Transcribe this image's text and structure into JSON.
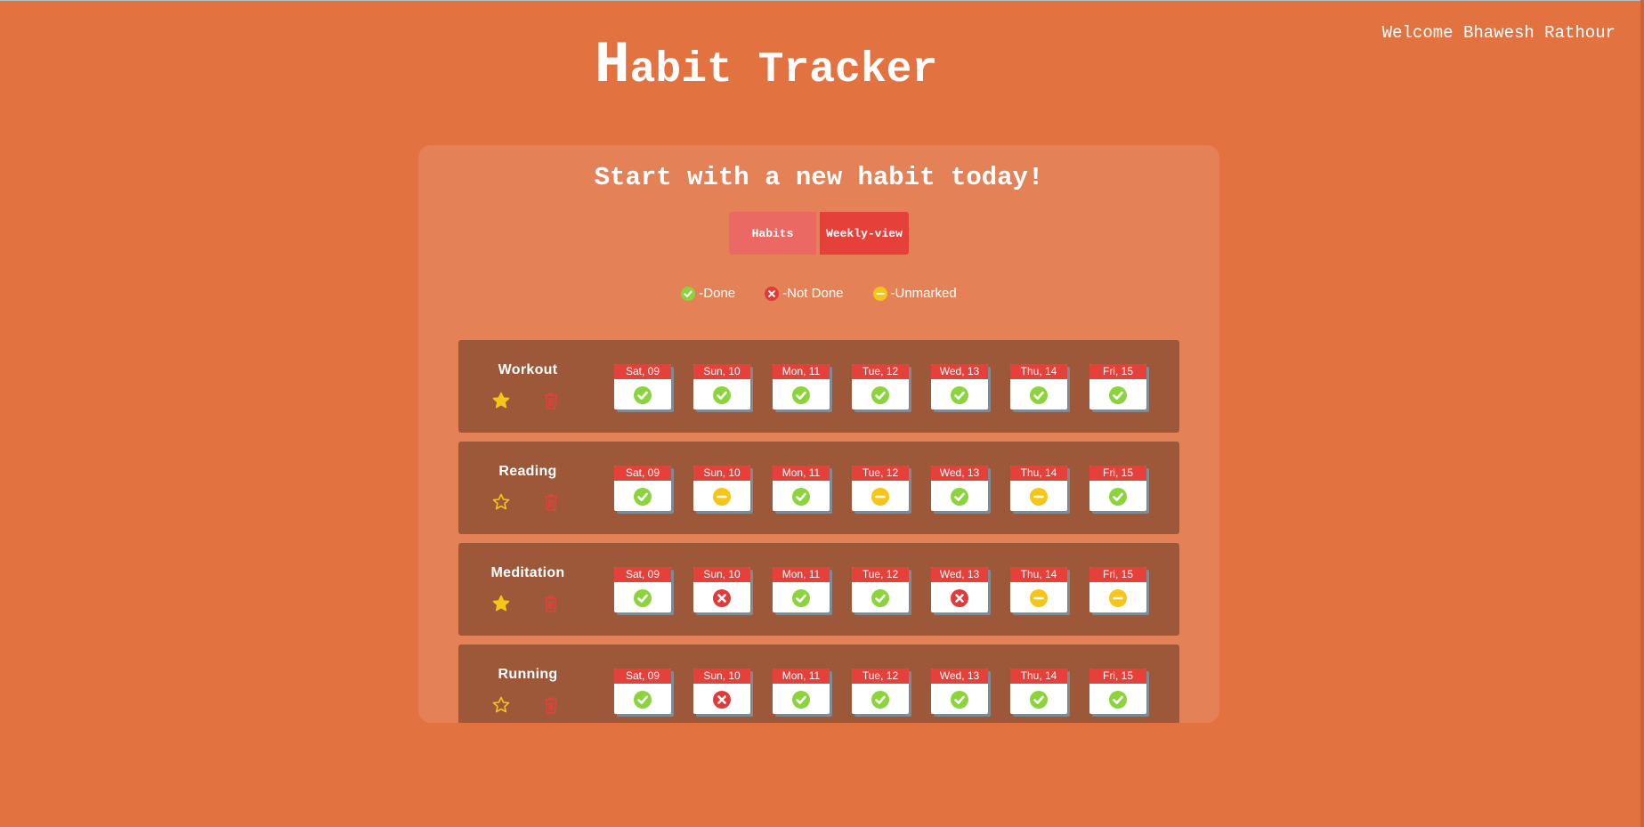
{
  "header": {
    "welcome": "Welcome Bhawesh Rathour",
    "title_initial": "H",
    "title_rest": "abit Tracker"
  },
  "main": {
    "subtitle": "Start with a new habit today!",
    "tabs": [
      {
        "label": "Habits"
      },
      {
        "label": "Weekly-view",
        "active": true
      }
    ],
    "legend": [
      {
        "status": "done",
        "label": "-Done"
      },
      {
        "status": "not-done",
        "label": "-Not Done"
      },
      {
        "status": "unmarked",
        "label": "-Unmarked"
      }
    ]
  },
  "days": [
    "Sat, 09",
    "Sun, 10",
    "Mon, 11",
    "Tue, 12",
    "Wed, 13",
    "Thu, 14",
    "Fri, 15"
  ],
  "habits": [
    {
      "name": "Workout",
      "favorite": true,
      "statuses": [
        "done",
        "done",
        "done",
        "done",
        "done",
        "done",
        "done"
      ]
    },
    {
      "name": "Reading",
      "favorite": false,
      "statuses": [
        "done",
        "unmarked",
        "done",
        "unmarked",
        "done",
        "unmarked",
        "done"
      ]
    },
    {
      "name": "Meditation",
      "favorite": true,
      "statuses": [
        "done",
        "not-done",
        "done",
        "done",
        "not-done",
        "unmarked",
        "unmarked"
      ]
    },
    {
      "name": "Running",
      "favorite": false,
      "statuses": [
        "done",
        "not-done",
        "done",
        "done",
        "done",
        "done",
        "done"
      ]
    }
  ],
  "colors": {
    "background": "#e27340",
    "card": "#e58157",
    "row": "#9c5839",
    "accent_red": "#e5403a",
    "done": "#8bd43c",
    "not_done": "#e03a3a",
    "unmarked": "#f5c518",
    "star": "#f5c518"
  },
  "icons": {
    "done": "check-circle-icon",
    "not_done": "x-circle-icon",
    "unmarked": "minus-circle-icon",
    "favorite": "star-icon",
    "delete": "trash-icon"
  }
}
